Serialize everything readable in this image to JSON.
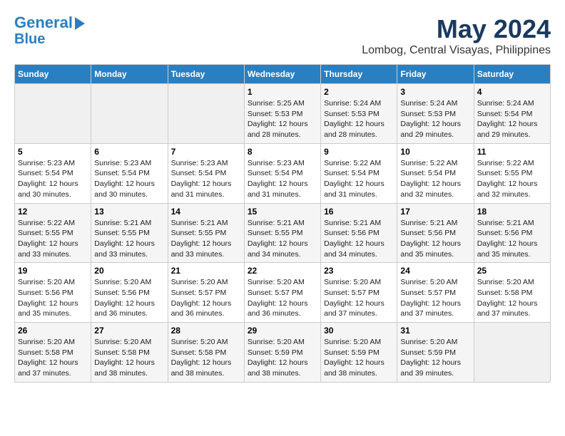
{
  "header": {
    "logo_line1": "General",
    "logo_line2": "Blue",
    "title": "May 2024",
    "subtitle": "Lombog, Central Visayas, Philippines"
  },
  "days_of_week": [
    "Sunday",
    "Monday",
    "Tuesday",
    "Wednesday",
    "Thursday",
    "Friday",
    "Saturday"
  ],
  "weeks": [
    [
      {
        "day": "",
        "info": ""
      },
      {
        "day": "",
        "info": ""
      },
      {
        "day": "",
        "info": ""
      },
      {
        "day": "1",
        "info": "Sunrise: 5:25 AM\nSunset: 5:53 PM\nDaylight: 12 hours\nand 28 minutes."
      },
      {
        "day": "2",
        "info": "Sunrise: 5:24 AM\nSunset: 5:53 PM\nDaylight: 12 hours\nand 28 minutes."
      },
      {
        "day": "3",
        "info": "Sunrise: 5:24 AM\nSunset: 5:53 PM\nDaylight: 12 hours\nand 29 minutes."
      },
      {
        "day": "4",
        "info": "Sunrise: 5:24 AM\nSunset: 5:54 PM\nDaylight: 12 hours\nand 29 minutes."
      }
    ],
    [
      {
        "day": "5",
        "info": "Sunrise: 5:23 AM\nSunset: 5:54 PM\nDaylight: 12 hours\nand 30 minutes."
      },
      {
        "day": "6",
        "info": "Sunrise: 5:23 AM\nSunset: 5:54 PM\nDaylight: 12 hours\nand 30 minutes."
      },
      {
        "day": "7",
        "info": "Sunrise: 5:23 AM\nSunset: 5:54 PM\nDaylight: 12 hours\nand 31 minutes."
      },
      {
        "day": "8",
        "info": "Sunrise: 5:23 AM\nSunset: 5:54 PM\nDaylight: 12 hours\nand 31 minutes."
      },
      {
        "day": "9",
        "info": "Sunrise: 5:22 AM\nSunset: 5:54 PM\nDaylight: 12 hours\nand 31 minutes."
      },
      {
        "day": "10",
        "info": "Sunrise: 5:22 AM\nSunset: 5:54 PM\nDaylight: 12 hours\nand 32 minutes."
      },
      {
        "day": "11",
        "info": "Sunrise: 5:22 AM\nSunset: 5:55 PM\nDaylight: 12 hours\nand 32 minutes."
      }
    ],
    [
      {
        "day": "12",
        "info": "Sunrise: 5:22 AM\nSunset: 5:55 PM\nDaylight: 12 hours\nand 33 minutes."
      },
      {
        "day": "13",
        "info": "Sunrise: 5:21 AM\nSunset: 5:55 PM\nDaylight: 12 hours\nand 33 minutes."
      },
      {
        "day": "14",
        "info": "Sunrise: 5:21 AM\nSunset: 5:55 PM\nDaylight: 12 hours\nand 33 minutes."
      },
      {
        "day": "15",
        "info": "Sunrise: 5:21 AM\nSunset: 5:55 PM\nDaylight: 12 hours\nand 34 minutes."
      },
      {
        "day": "16",
        "info": "Sunrise: 5:21 AM\nSunset: 5:56 PM\nDaylight: 12 hours\nand 34 minutes."
      },
      {
        "day": "17",
        "info": "Sunrise: 5:21 AM\nSunset: 5:56 PM\nDaylight: 12 hours\nand 35 minutes."
      },
      {
        "day": "18",
        "info": "Sunrise: 5:21 AM\nSunset: 5:56 PM\nDaylight: 12 hours\nand 35 minutes."
      }
    ],
    [
      {
        "day": "19",
        "info": "Sunrise: 5:20 AM\nSunset: 5:56 PM\nDaylight: 12 hours\nand 35 minutes."
      },
      {
        "day": "20",
        "info": "Sunrise: 5:20 AM\nSunset: 5:56 PM\nDaylight: 12 hours\nand 36 minutes."
      },
      {
        "day": "21",
        "info": "Sunrise: 5:20 AM\nSunset: 5:57 PM\nDaylight: 12 hours\nand 36 minutes."
      },
      {
        "day": "22",
        "info": "Sunrise: 5:20 AM\nSunset: 5:57 PM\nDaylight: 12 hours\nand 36 minutes."
      },
      {
        "day": "23",
        "info": "Sunrise: 5:20 AM\nSunset: 5:57 PM\nDaylight: 12 hours\nand 37 minutes."
      },
      {
        "day": "24",
        "info": "Sunrise: 5:20 AM\nSunset: 5:57 PM\nDaylight: 12 hours\nand 37 minutes."
      },
      {
        "day": "25",
        "info": "Sunrise: 5:20 AM\nSunset: 5:58 PM\nDaylight: 12 hours\nand 37 minutes."
      }
    ],
    [
      {
        "day": "26",
        "info": "Sunrise: 5:20 AM\nSunset: 5:58 PM\nDaylight: 12 hours\nand 37 minutes."
      },
      {
        "day": "27",
        "info": "Sunrise: 5:20 AM\nSunset: 5:58 PM\nDaylight: 12 hours\nand 38 minutes."
      },
      {
        "day": "28",
        "info": "Sunrise: 5:20 AM\nSunset: 5:58 PM\nDaylight: 12 hours\nand 38 minutes."
      },
      {
        "day": "29",
        "info": "Sunrise: 5:20 AM\nSunset: 5:59 PM\nDaylight: 12 hours\nand 38 minutes."
      },
      {
        "day": "30",
        "info": "Sunrise: 5:20 AM\nSunset: 5:59 PM\nDaylight: 12 hours\nand 38 minutes."
      },
      {
        "day": "31",
        "info": "Sunrise: 5:20 AM\nSunset: 5:59 PM\nDaylight: 12 hours\nand 39 minutes."
      },
      {
        "day": "",
        "info": ""
      }
    ]
  ]
}
